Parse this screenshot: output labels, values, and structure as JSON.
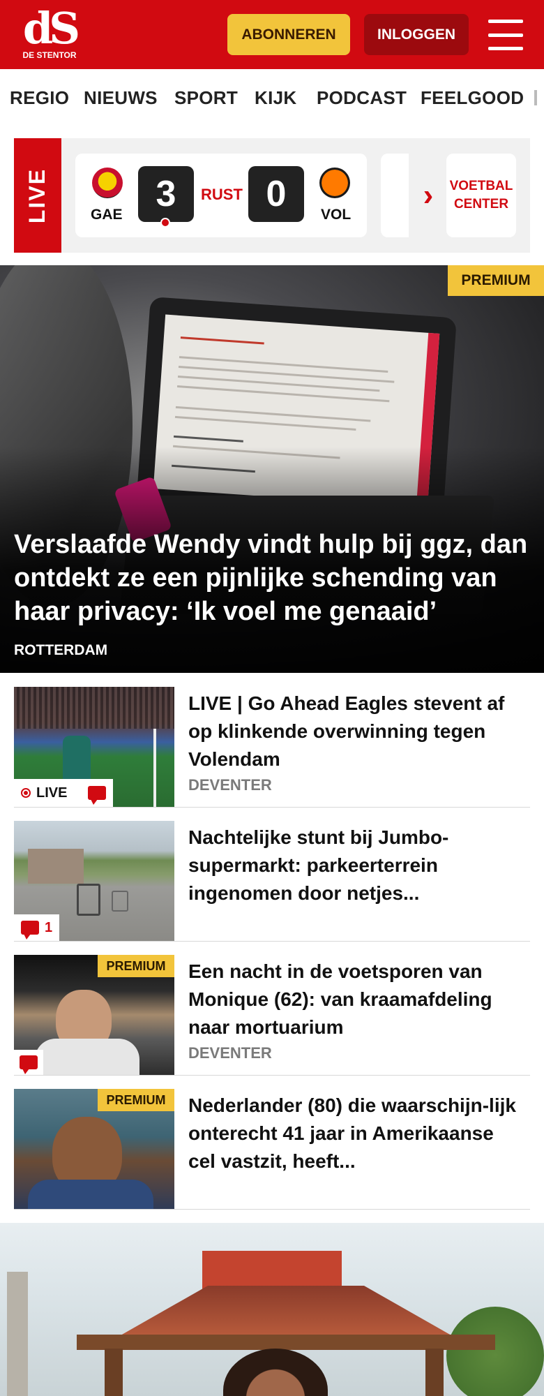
{
  "header": {
    "logo_mark": "dS",
    "logo_sub": "DE STENTOR",
    "subscribe_label": "ABONNEREN",
    "login_label": "INLOGGEN",
    "menu_icon": "hamburger-menu-icon",
    "brand_color": "#d10a11",
    "subscribe_color": "#f2c43b"
  },
  "nav": {
    "items": [
      "REGIO",
      "NIEUWS",
      "SPORT",
      "KIJK",
      "PODCAST",
      "FEELGOOD"
    ]
  },
  "live": {
    "tag": "LIVE",
    "match": {
      "home_code": "GAE",
      "home_score": "3",
      "status": "RUST",
      "away_score": "0",
      "away_code": "VOL"
    },
    "arrow_icon": "chevron-right-icon",
    "voetbal_center": "VOETBAL CENTER"
  },
  "hero": {
    "premium": "PREMIUM",
    "title": "Verslaafde Wendy vindt hulp bij ggz, dan ontdekt ze een pijnlijke schending van haar privacy: ‘Ik voel me genaaid’",
    "place": "ROTTERDAM"
  },
  "articles": [
    {
      "title": "LIVE | Go Ahead Eagles stevent af op klinkende overwinning tegen Volendam",
      "place": "DEVENTER",
      "badge_live": "LIVE",
      "comments": ""
    },
    {
      "title": "Nachtelijke stunt bij Jumbo-supermarkt: parkeerterrein ingenomen door netjes...",
      "place": "",
      "comments": "1"
    },
    {
      "title": "Een nacht in de voetsporen van Monique (62): van kraamafdeling naar mortuarium",
      "place": "DEVENTER",
      "premium": "PREMIUM",
      "comments": ""
    },
    {
      "title": "Nederlander (80) die waarschijn-lijk onterecht 41 jaar in Amerikaanse cel vastzit, heeft...",
      "place": "",
      "premium": "PREMIUM"
    }
  ]
}
